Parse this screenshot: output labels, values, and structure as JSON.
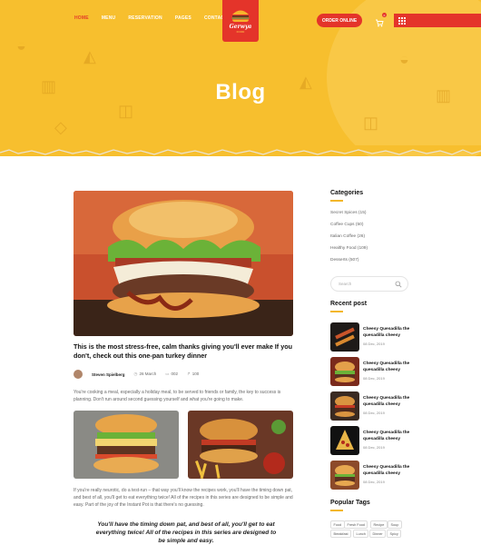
{
  "nav": {
    "items": [
      "HOME",
      "MENU",
      "RESERVATION",
      "PAGES",
      "CONTACT"
    ],
    "active_index": 0
  },
  "logo": {
    "name": "Gerwya",
    "tagline": "FOOD"
  },
  "header": {
    "order_label": "ORDER ONLINE",
    "cart_count": "0",
    "page_title": "Blog"
  },
  "post": {
    "title": "This is the most stress-free, calm thanks giving you'll ever make If you don't, check out this one-pan turkey dinner",
    "author": "Steven Spielberg",
    "date": "26 March",
    "comments": "002",
    "shares": "100",
    "excerpt": "You're cooking a meal, especially a holiday meal, to be served to friends or family, the key to success is planning. Don't run around second guessing yourself and what you're going to make.",
    "body": "If you're really neurotic, do a test-run – that way you'll know the recipes work, you'll have the timing down pat, and best of all, you'll get to eat everything twice! All of the recipes in this series are designed to be simple and easy. Part of the joy of the Instant Pot is that there's no guessing.",
    "quote": "You'll have the timing down pat, and best of all, you'll get to eat everything twice! All of the recipes in this series are designed to be simple and easy."
  },
  "sidebar": {
    "categories_title": "Categories",
    "categories": [
      "Secret Spices (15)",
      "Coffee Cups (50)",
      "Italian Coffee (26)",
      "Healthy Food (109)",
      "Desserts (507)"
    ],
    "search_placeholder": "Search",
    "recent_title": "Recent post",
    "recent": [
      {
        "title": "Cheesy Quesadilla the quesadilla cheesy",
        "date": "08 Dec, 2019"
      },
      {
        "title": "Cheesy Quesadilla the quesadilla cheesy",
        "date": "08 Dec, 2019"
      },
      {
        "title": "Cheesy Quesadilla the quesadilla cheesy",
        "date": "08 Dec, 2019"
      },
      {
        "title": "Cheesy Quesadilla the quesadilla cheesy",
        "date": "08 Dec, 2019"
      },
      {
        "title": "Cheesy Quesadilla the quesadilla cheesy",
        "date": "08 Dec, 2019"
      }
    ],
    "tags_title": "Popular Tags",
    "tags": [
      "Food",
      "Fresh Food",
      "Recipe",
      "Soup",
      "Breakfast",
      "Lunch",
      "Dinner",
      "Spicy"
    ]
  },
  "colors": {
    "accent": "#e4342a",
    "hero": "#f7bf2e",
    "underline": "#f3b72a"
  },
  "icons": [
    "cart-icon",
    "grid-menu-icon",
    "search-icon",
    "calendar-icon",
    "comment-icon",
    "share-icon"
  ]
}
